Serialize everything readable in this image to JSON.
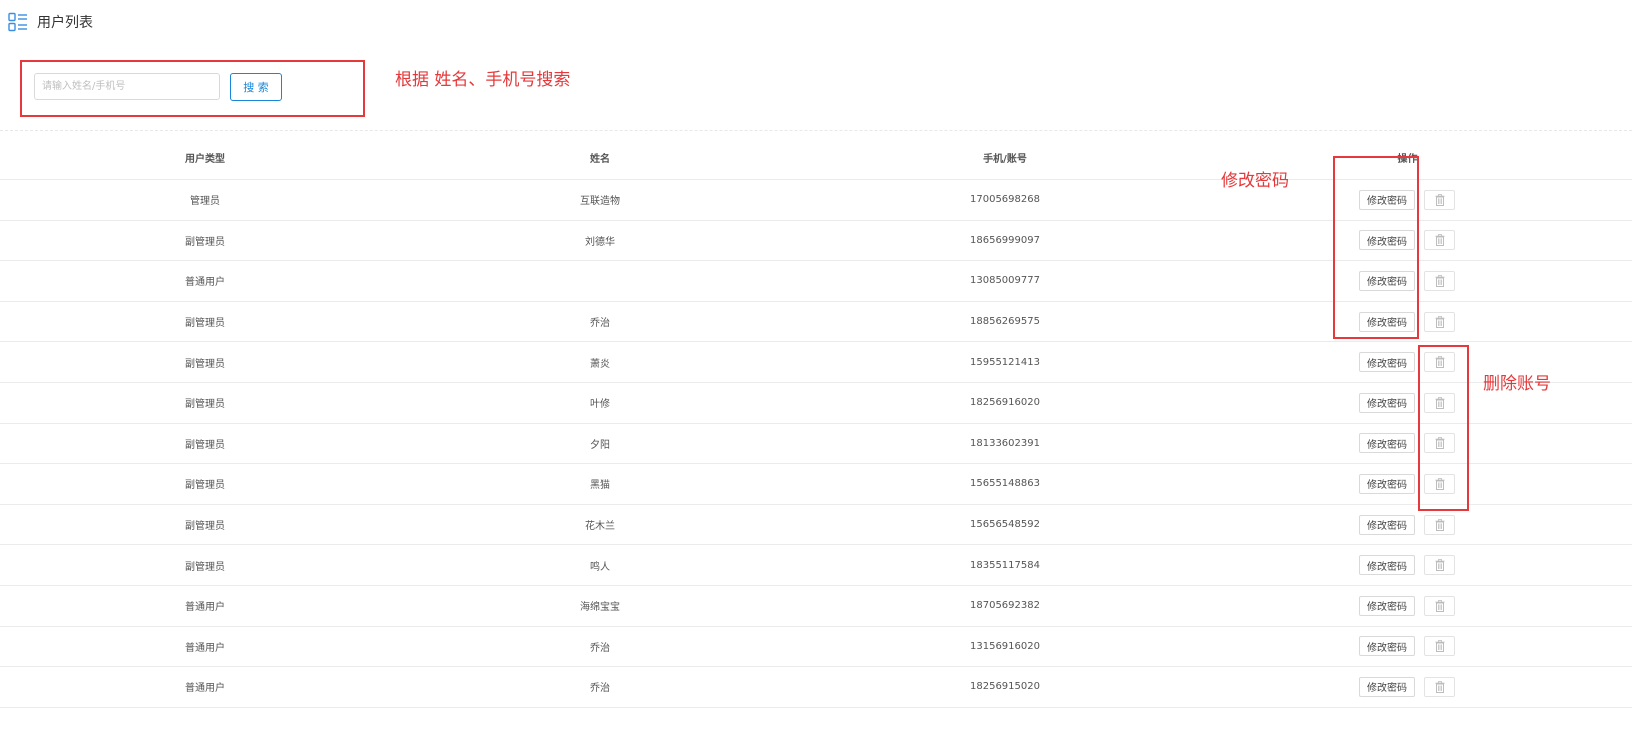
{
  "header": {
    "title": "用户列表",
    "icon": "list-icon"
  },
  "search": {
    "placeholder": "请输入姓名/手机号",
    "value": "",
    "button_label": "搜 索"
  },
  "annotations": {
    "search_note": "根据 姓名、手机号搜索",
    "password_note": "修改密码",
    "delete_note": "删除账号",
    "color": "#e5393b"
  },
  "table": {
    "columns": [
      "用户类型",
      "姓名",
      "手机/账号",
      "操作"
    ],
    "rows": [
      {
        "type": "管理员",
        "name": "互联造物",
        "phone": "17005698268"
      },
      {
        "type": "副管理员",
        "name": "刘德华",
        "phone": "18656999097"
      },
      {
        "type": "普通用户",
        "name": "",
        "phone": "13085009777"
      },
      {
        "type": "副管理员",
        "name": "乔治",
        "phone": "18856269575"
      },
      {
        "type": "副管理员",
        "name": "萧炎",
        "phone": "15955121413"
      },
      {
        "type": "副管理员",
        "name": "叶修",
        "phone": "18256916020"
      },
      {
        "type": "副管理员",
        "name": "夕阳",
        "phone": "18133602391"
      },
      {
        "type": "副管理员",
        "name": "黑猫",
        "phone": "15655148863"
      },
      {
        "type": "副管理员",
        "name": "花木兰",
        "phone": "15656548592"
      },
      {
        "type": "副管理员",
        "name": "鸣人",
        "phone": "18355117584"
      },
      {
        "type": "普通用户",
        "name": "海绵宝宝",
        "phone": "18705692382"
      },
      {
        "type": "普通用户",
        "name": "乔治",
        "phone": "13156916020"
      },
      {
        "type": "普通用户",
        "name": "乔治",
        "phone": "18256915020"
      }
    ],
    "row_action_label": "修改密码",
    "delete_icon": "trash-icon"
  },
  "colors": {
    "primary": "#1a86d8",
    "annotation": "#e5393b",
    "border": "#ebebeb"
  }
}
